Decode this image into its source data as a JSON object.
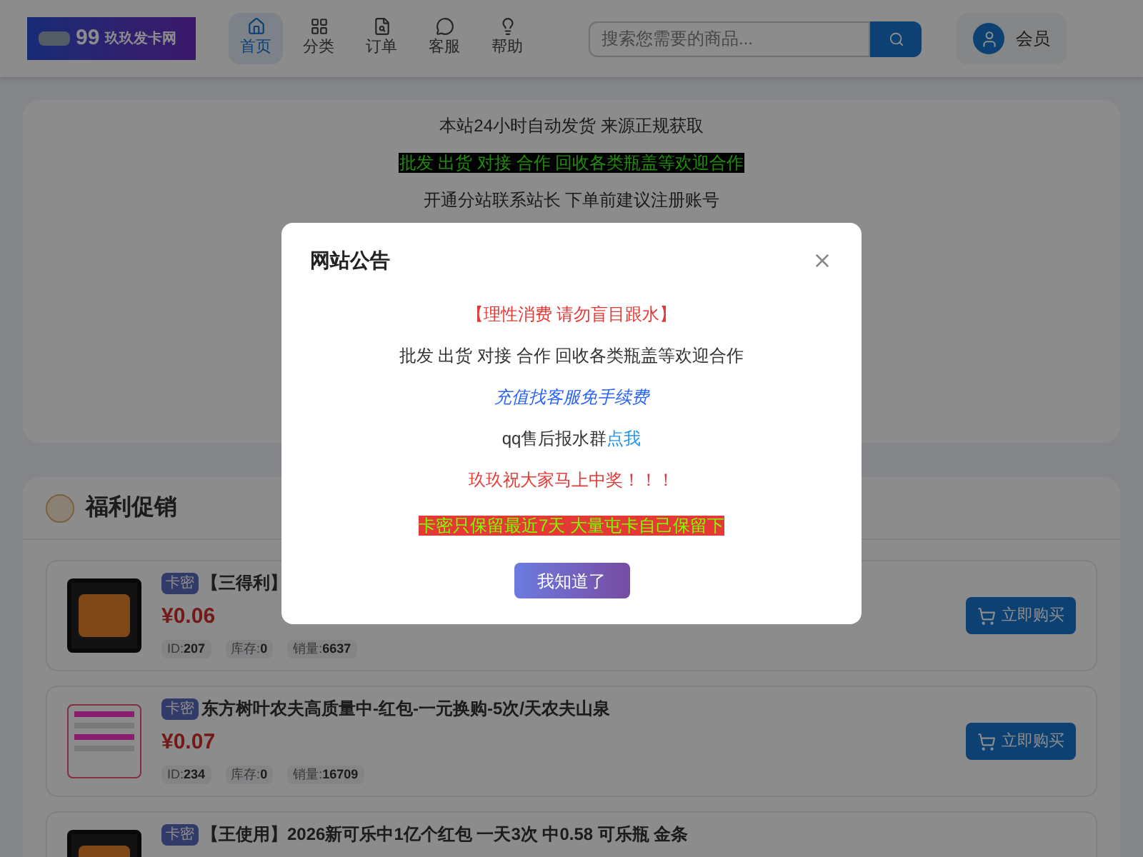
{
  "header": {
    "logo": {
      "number": "99",
      "name": "玖玖发卡网"
    },
    "nav": [
      {
        "label": "首页",
        "selected": true
      },
      {
        "label": "分类",
        "selected": false
      },
      {
        "label": "订单",
        "selected": false
      },
      {
        "label": "客服",
        "selected": false
      },
      {
        "label": "帮助",
        "selected": false
      }
    ],
    "search": {
      "placeholder": "搜索您需要的商品..."
    },
    "member": {
      "label": "会员"
    }
  },
  "notice_card": {
    "lines": [
      {
        "kind": "plain",
        "text": "本站24小时自动发货 来源正规获取"
      },
      {
        "kind": "green_on_black",
        "text": "批发 出货 对接 合作 回收各类瓶盖等欢迎合作"
      },
      {
        "kind": "plain",
        "text": "开通分站联系站长 下单前建议注册账号"
      }
    ]
  },
  "promo": {
    "title": "福利促销",
    "products": [
      {
        "tag": "卡密",
        "title": "【三得利】",
        "price": "¥0.06",
        "id_label": "ID:",
        "id": "207",
        "stock_label": "库存:",
        "stock": "0",
        "sales_label": "销量:",
        "sales": "6637",
        "button": "立即购买"
      },
      {
        "tag": "卡密",
        "title": "东方树叶农夫高质量中-红包-一元换购-5次/天农夫山泉",
        "price": "¥0.07",
        "id_label": "ID:",
        "id": "234",
        "stock_label": "库存:",
        "stock": "0",
        "sales_label": "销量:",
        "sales": "16709",
        "button": "立即购买"
      },
      {
        "tag": "卡密",
        "title": "【王使用】2026新可乐中1亿个红包 一天3次 中0.58 可乐瓶 金条"
      }
    ]
  },
  "dialog": {
    "title": "网站公告",
    "lines": [
      {
        "kind": "red",
        "text": "【理性消费 请勿盲目跟水】"
      },
      {
        "kind": "plain",
        "text": "批发 出货 对接 合作 回收各类瓶盖等欢迎合作"
      },
      {
        "kind": "blue_italic",
        "text": "充值找客服免手续费"
      },
      {
        "kind": "with_link",
        "text": "qq售后报水群",
        "link": "点我"
      },
      {
        "kind": "red",
        "text": "玖玖祝大家马上中奖！！！"
      },
      {
        "kind": "green_on_red",
        "text": "卡密只保留最近7天 大量屯卡自己保留下"
      }
    ],
    "button": "我知道了"
  }
}
